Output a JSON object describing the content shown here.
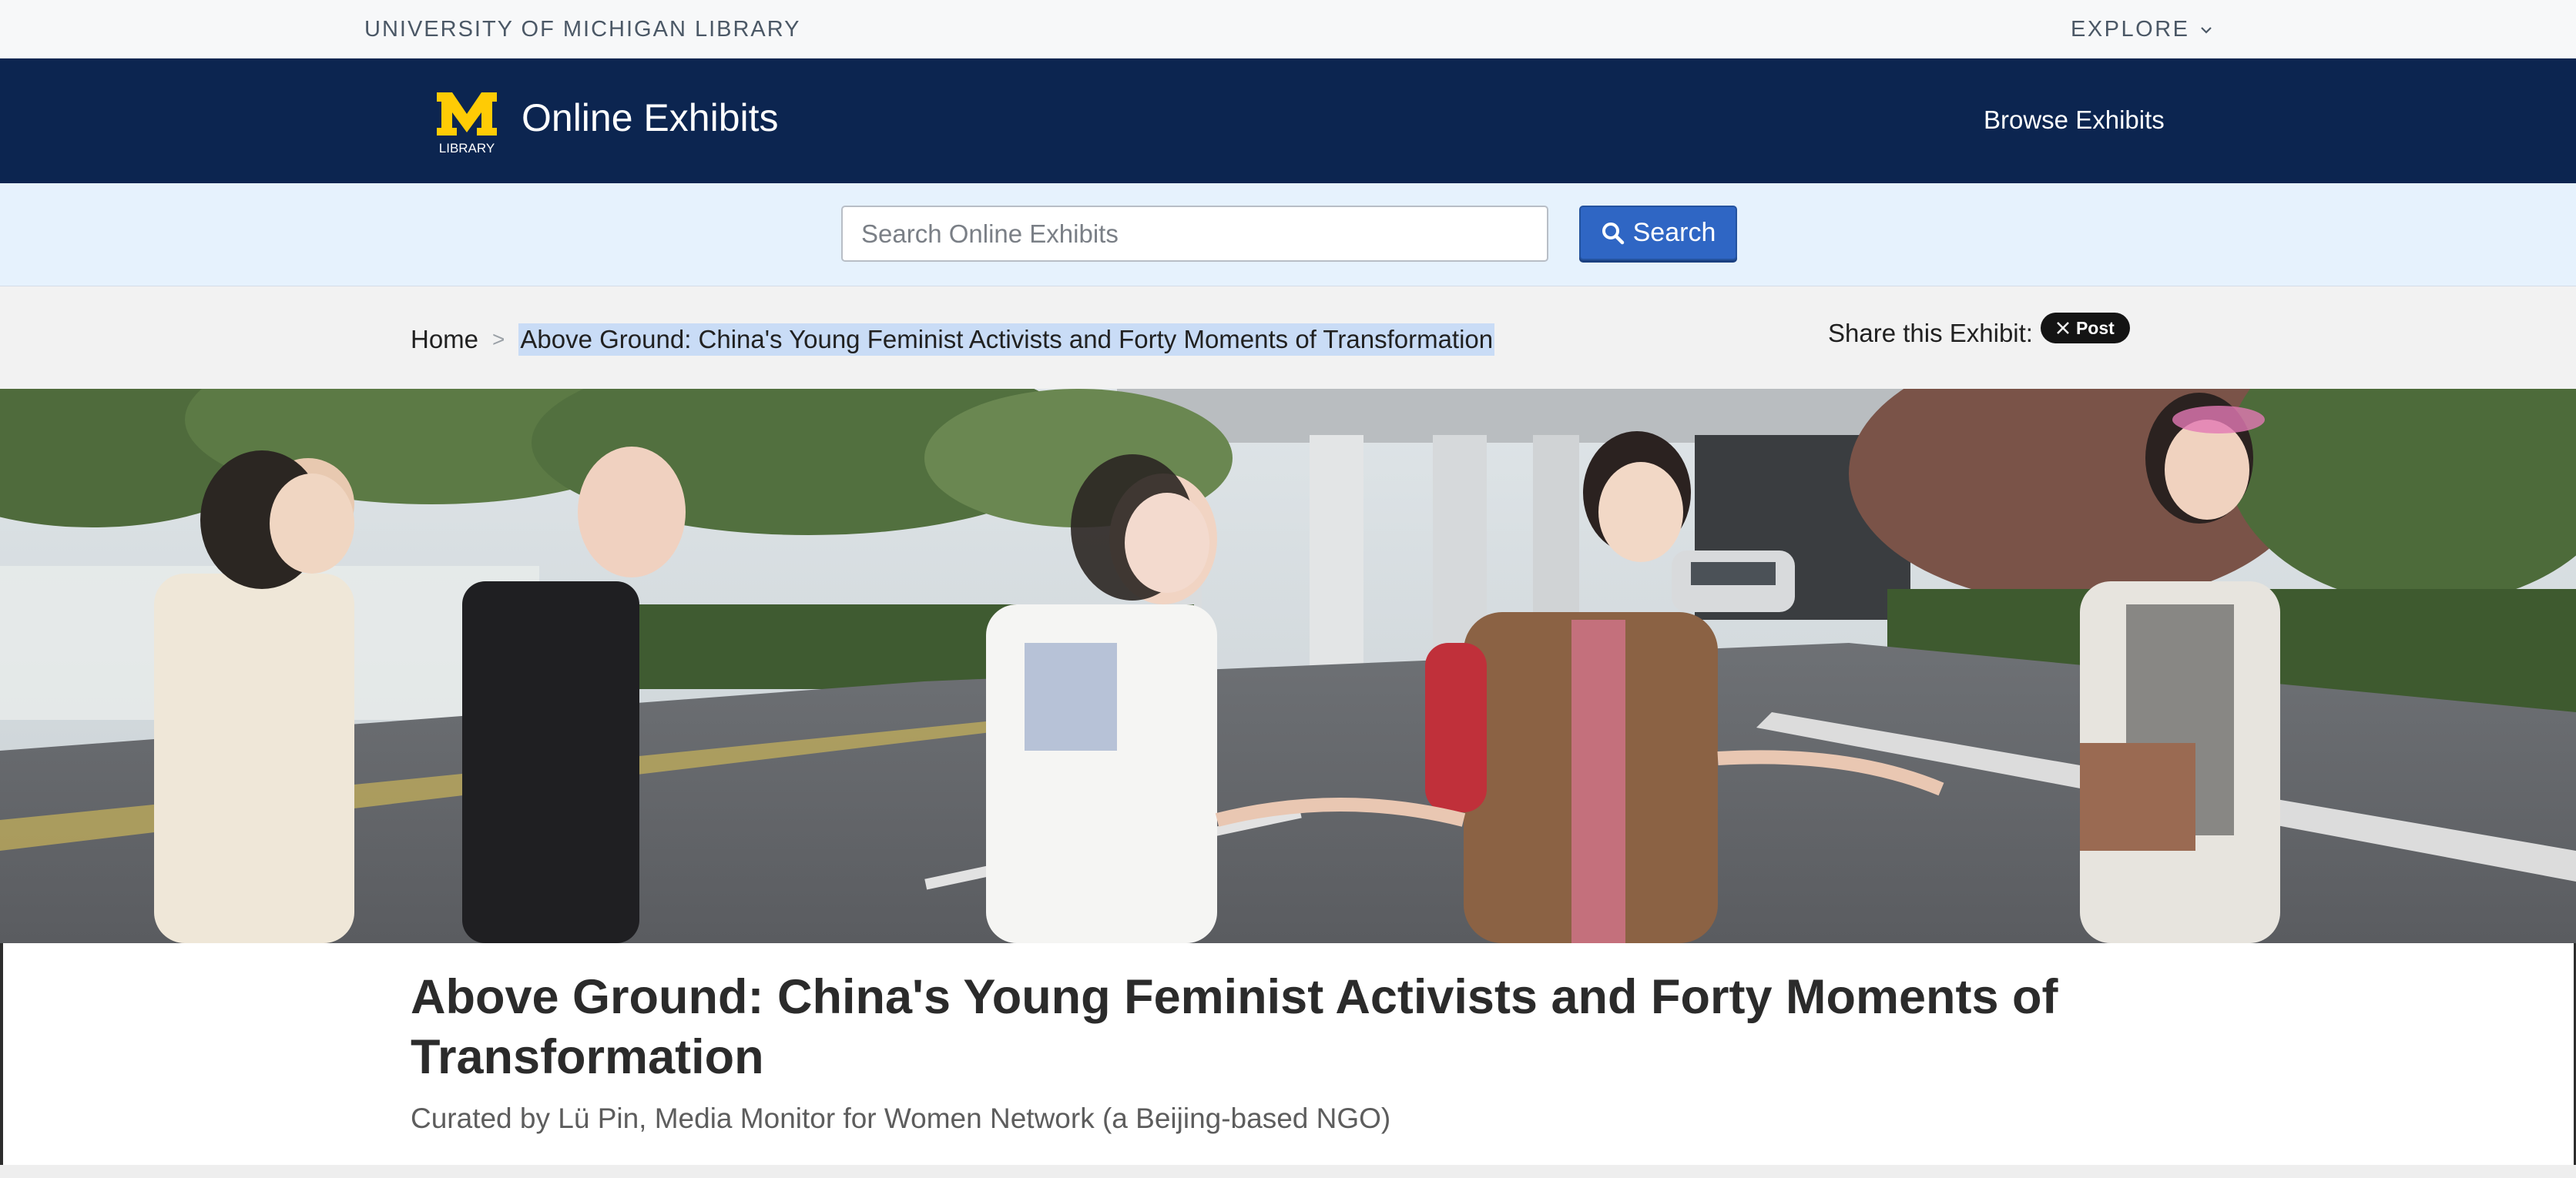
{
  "utility_bar": {
    "org_name": "UNIVERSITY OF MICHIGAN LIBRARY",
    "explore_label": "EXPLORE"
  },
  "header": {
    "logo_letter": "M",
    "logo_sub": "LIBRARY",
    "site_title": "Online Exhibits",
    "browse_label": "Browse Exhibits"
  },
  "search": {
    "placeholder": "Search Online Exhibits",
    "button_label": "Search"
  },
  "breadcrumb": {
    "home": "Home",
    "separator": ">",
    "current": "Above Ground: China's Young Feminist Activists and Forty Moments of Transformation"
  },
  "share": {
    "label": "Share this Exhibit:",
    "post_label": "Post"
  },
  "exhibit": {
    "title": "Above Ground: China's Young Feminist Activists and Forty Moments of Transformation",
    "curator": "Curated by Lü Pin, Media Monitor for Women Network (a Beijing-based NGO)"
  },
  "colors": {
    "navy": "#0c2550",
    "maize": "#ffcb05",
    "search_band": "#e6f2fd",
    "button_blue": "#2f66c4"
  },
  "icons": [
    "chevron-down-icon",
    "search-icon",
    "x-logo-icon",
    "michigan-m-logo"
  ]
}
